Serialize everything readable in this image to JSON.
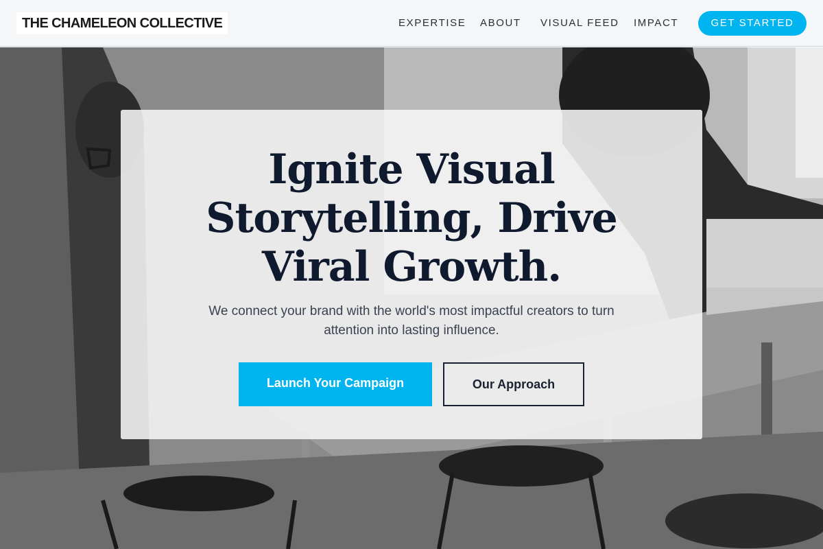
{
  "header": {
    "brand": "THE CHAMELEON COLLECTIVE",
    "nav": {
      "expertise": "EXPERTISE",
      "about": "ABOUT",
      "visual_feed": "VISUAL FEED",
      "impact": "IMPACT"
    },
    "cta": "GET STARTED"
  },
  "hero": {
    "title_lines": [
      "Ignite Visual",
      "Storytelling, Drive",
      "Viral Growth."
    ],
    "subtitle_lines": [
      "We connect your brand with the world's most impactful creators to turn",
      "attention into lasting influence."
    ],
    "primary_button": "Launch Your Campaign",
    "secondary_button": "Our Approach"
  },
  "colors": {
    "accent": "#00b4f0",
    "title_text": "#0f1a2e",
    "header_bg": "#f5f6f7"
  }
}
